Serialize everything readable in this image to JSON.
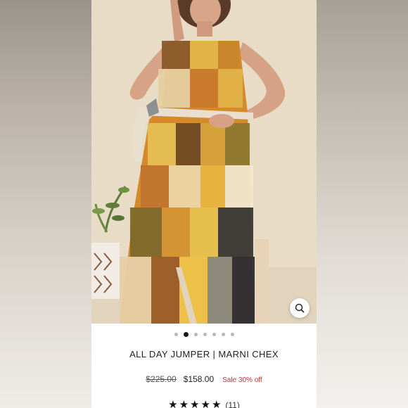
{
  "product": {
    "title": "ALL DAY JUMPER | MARNI CHEX",
    "original_price": "$225.00",
    "sale_price": "$158.00",
    "sale_badge": "Sale 30% off",
    "rating_stars": 5,
    "review_count": "(11)"
  },
  "carousel": {
    "slide_count": 7,
    "active_index": 1
  },
  "icons": {
    "zoom": "magnifier-icon",
    "star": "star-icon"
  },
  "colors": {
    "sale_red": "#b23a2e",
    "dot_active": "#1a1a1a",
    "dot_inactive": "#b8b8b8"
  }
}
